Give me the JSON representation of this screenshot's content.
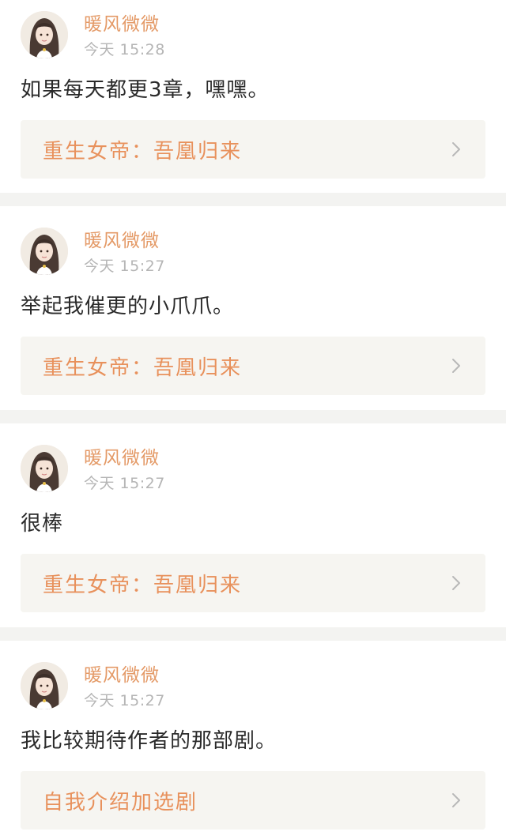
{
  "colors": {
    "username": "#e49a67",
    "timestamp": "#b5b5b5",
    "book_title": "#e8915c",
    "card_bg": "#f6f5f1",
    "separator_bg": "#f3f3f1"
  },
  "icons": {
    "avatar": "avatar-icon",
    "chevron": "chevron-right-icon"
  },
  "posts": [
    {
      "username": "暖风微微",
      "time": "今天 15:28",
      "content": "如果每天都更3章，嘿嘿。",
      "book_title": "重生女帝：吾凰归来"
    },
    {
      "username": "暖风微微",
      "time": "今天 15:27",
      "content": "举起我催更的小爪爪。",
      "book_title": "重生女帝：吾凰归来"
    },
    {
      "username": "暖风微微",
      "time": "今天 15:27",
      "content": "很棒",
      "book_title": "重生女帝：吾凰归来"
    },
    {
      "username": "暖风微微",
      "time": "今天 15:27",
      "content": "我比较期待作者的那部剧。",
      "book_title": "自我介绍加选剧"
    }
  ]
}
